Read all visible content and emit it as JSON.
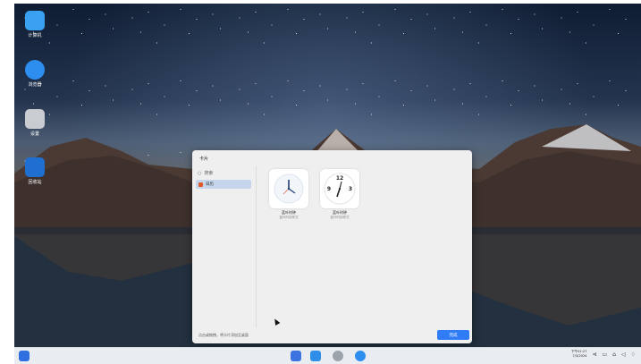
{
  "desktop": {
    "icons": [
      {
        "label": "计算机"
      },
      {
        "label": "浏览器"
      },
      {
        "label": "设置"
      },
      {
        "label": "回收站"
      }
    ]
  },
  "dialog": {
    "title": "卡片",
    "search_placeholder": "搜索",
    "nav_items": [
      {
        "label": "日历"
      }
    ],
    "cards": [
      {
        "title": "蓝叶时钟",
        "subtitle": "蓝叶时钟样式"
      },
      {
        "title": "蓝叶时钟",
        "subtitle": "蓝叶时钟样式"
      }
    ],
    "hint": "点击或拖拽，将卡片添加至桌面",
    "done_label": "完成"
  },
  "taskbar": {
    "clock_time": "下午01:27",
    "clock_date": "7/3/2024"
  },
  "colors": {
    "accent": "#2f7cf6",
    "selected_nav": "#c5d6ec",
    "taskbar": "#e9edf2"
  }
}
